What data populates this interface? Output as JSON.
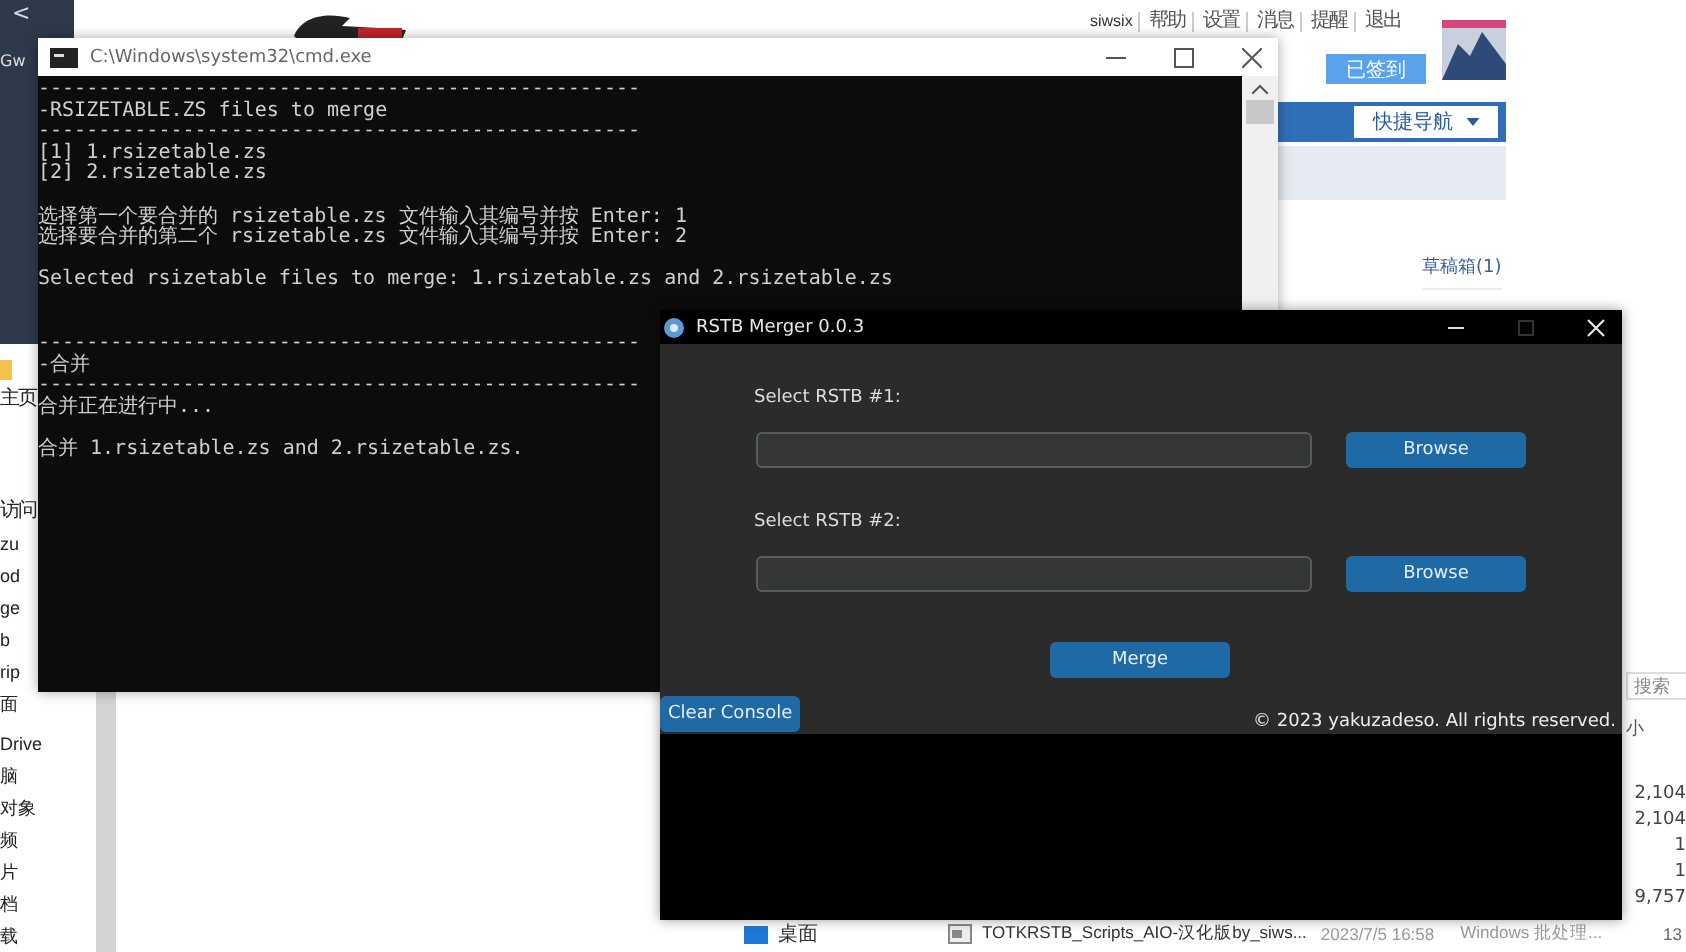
{
  "browser": {
    "back": "<",
    "user": "siwsix",
    "links": [
      "帮助",
      "设置",
      "消息",
      "提醒",
      "退出"
    ],
    "sign_button": "已签到",
    "nav_button": "快捷导航",
    "drafts_link": "草稿箱(1)",
    "side_text": "Gw"
  },
  "explorer": {
    "nav_items": [
      "主页",
      "访问",
      "zu",
      "od",
      "ge",
      "b",
      "rip",
      "面",
      "Drive",
      "脑",
      "对象",
      "频",
      "片",
      "档",
      "载"
    ],
    "search_placeholder": "搜索",
    "size_header": "小",
    "sizes": [
      "2,104",
      "2,104",
      "1",
      "1",
      "9,757"
    ],
    "bottom_row": {
      "folder": "桌面",
      "name": "TOTKRSTB_Scripts_AIO-汉化版by_siws...",
      "date": "2023/7/5 16:58",
      "type": "Windows 批处理...",
      "size": "13"
    }
  },
  "cmd": {
    "title": "C:\\Windows\\system32\\cmd.exe",
    "lines": [
      {
        "kind": "text",
        "text": "--------------------------------------------------"
      },
      {
        "kind": "text",
        "text": "-RSIZETABLE.ZS files to merge"
      },
      {
        "kind": "text",
        "text": "--------------------------------------------------"
      },
      {
        "kind": "text",
        "text": "[1] 1.rsizetable.zs"
      },
      {
        "kind": "text",
        "text": "[2] 2.rsizetable.zs"
      },
      {
        "kind": "blank"
      },
      {
        "kind": "text",
        "text": "选择第一个要合并的 rsizetable.zs 文件输入其编号并按 Enter: 1"
      },
      {
        "kind": "text",
        "text": "选择要合并的第二个 rsizetable.zs 文件输入其编号并按 Enter: 2"
      },
      {
        "kind": "blank"
      },
      {
        "kind": "text",
        "text": "Selected rsizetable files to merge: 1.rsizetable.zs and 2.rsizetable.zs"
      },
      {
        "kind": "blank"
      },
      {
        "kind": "blank"
      },
      {
        "kind": "text",
        "text": "--------------------------------------------------"
      },
      {
        "kind": "text",
        "text": "-合并"
      },
      {
        "kind": "text",
        "text": "--------------------------------------------------"
      },
      {
        "kind": "text",
        "text": "合并正在进行中..."
      },
      {
        "kind": "blank"
      },
      {
        "kind": "text",
        "text": "合并 1.rsizetable.zs and 2.rsizetable.zs."
      }
    ]
  },
  "merger": {
    "title": "RSTB Merger 0.0.3",
    "fields": [
      {
        "label": "Select RSTB #1:",
        "button": "Browse"
      },
      {
        "label": "Select RSTB #2:",
        "button": "Browse"
      }
    ],
    "merge_button": "Merge",
    "clear_button": "Clear Console",
    "copyright": "© 2023 yakuzadeso. All rights reserved."
  }
}
